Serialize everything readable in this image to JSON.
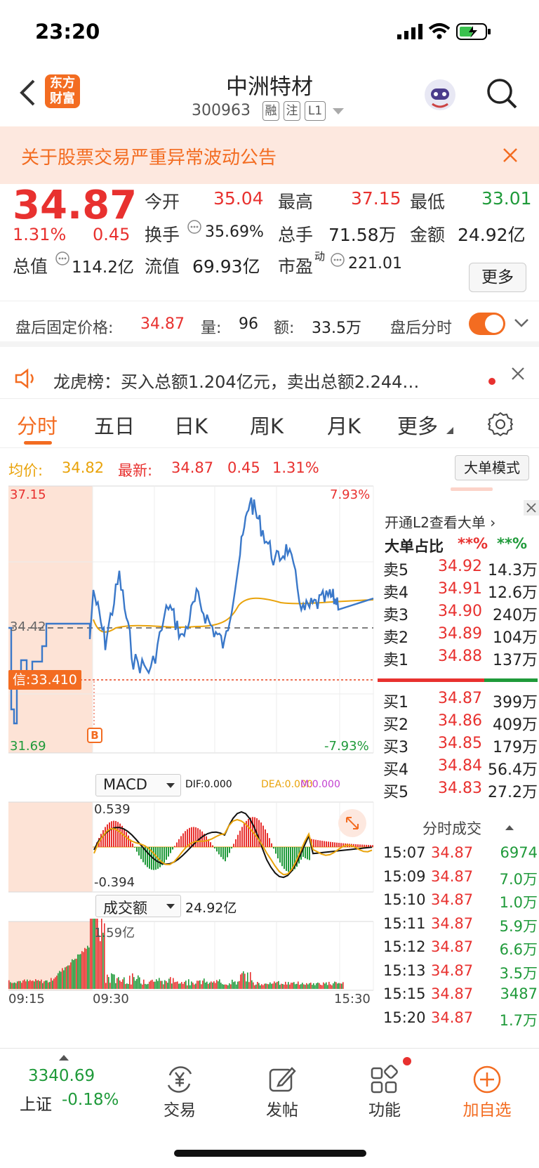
{
  "status": {
    "time": "23:20"
  },
  "header": {
    "title": "中洲特材",
    "code": "300963",
    "badges": [
      "融",
      "注",
      "L1"
    ],
    "logo_line1": "东方",
    "logo_line2": "财富"
  },
  "notice": {
    "text": "关于股票交易严重异常波动公告"
  },
  "quote": {
    "price": "34.87",
    "change_pct": "1.31%",
    "change": "0.45",
    "open_label": "今开",
    "open": "35.04",
    "high_label": "最高",
    "high": "37.15",
    "low_label": "最低",
    "low": "33.01",
    "turnover_label": "换手",
    "turnover": "35.69%",
    "volume_label": "总手",
    "volume": "71.58万",
    "amount_label": "金额",
    "amount": "24.92亿",
    "mktcap_label": "总值",
    "mktcap": "114.2亿",
    "float_label": "流值",
    "float_cap": "69.93亿",
    "pe_label": "市盈",
    "pe_sup": "动",
    "pe": "221.01",
    "more": "更多"
  },
  "afterhours": {
    "price_label": "盘后固定价格:",
    "price": "34.87",
    "vol_label": "量:",
    "vol": "96",
    "amt_label": "额:",
    "amt": "33.5万",
    "timeshare_label": "盘后分时"
  },
  "lhb": {
    "text": "龙虎榜：买入总额1.204亿元，卖出总额2.244…"
  },
  "tabs": [
    "分时",
    "五日",
    "日K",
    "周K",
    "月K",
    "更多"
  ],
  "infoline": {
    "avg_label": "均价:",
    "avg": "34.82",
    "latest_label": "最新:",
    "latest": "34.87",
    "chg": "0.45",
    "pct": "1.31%",
    "bigmode": "大单模式"
  },
  "chart": {
    "y_top": "37.15",
    "y_mid": "34.42",
    "y_bot": "31.69",
    "pct_top": "7.93%",
    "pct_bot": "-7.93%",
    "signal_label": "信:33.410",
    "b_marker": "B",
    "macd_label": "MACD",
    "dif": "DIF:0.000",
    "dea": "DEA:0.000",
    "m": "M:0.000",
    "macd_top": "0.539",
    "macd_bot": "-0.394",
    "vol_label": "成交额",
    "vol_total": "24.92亿",
    "vol_max": "1.59亿",
    "t_start": "09:15",
    "t_open": "09:30",
    "t_end": "15:30"
  },
  "orderbook": {
    "l2_text": "开通L2查看大单",
    "ratio_label": "大单占比",
    "ratio_buy": "**%",
    "ratio_sell": "**%",
    "asks": [
      {
        "label": "卖5",
        "price": "34.92",
        "vol": "14.3万"
      },
      {
        "label": "卖4",
        "price": "34.91",
        "vol": "12.6万"
      },
      {
        "label": "卖3",
        "price": "34.90",
        "vol": "240万"
      },
      {
        "label": "卖2",
        "price": "34.89",
        "vol": "104万"
      },
      {
        "label": "卖1",
        "price": "34.88",
        "vol": "137万"
      }
    ],
    "bids": [
      {
        "label": "买1",
        "price": "34.87",
        "vol": "399万"
      },
      {
        "label": "买2",
        "price": "34.86",
        "vol": "409万"
      },
      {
        "label": "买3",
        "price": "34.85",
        "vol": "179万"
      },
      {
        "label": "买4",
        "price": "34.84",
        "vol": "56.4万"
      },
      {
        "label": "买5",
        "price": "34.83",
        "vol": "27.2万"
      }
    ],
    "trades_title": "分时成交",
    "trades": [
      {
        "t": "15:07",
        "p": "34.87",
        "v": "6974"
      },
      {
        "t": "15:09",
        "p": "34.87",
        "v": "7.0万"
      },
      {
        "t": "15:10",
        "p": "34.87",
        "v": "1.0万"
      },
      {
        "t": "15:11",
        "p": "34.87",
        "v": "5.9万"
      },
      {
        "t": "15:12",
        "p": "34.87",
        "v": "6.6万"
      },
      {
        "t": "15:13",
        "p": "34.87",
        "v": "3.5万"
      },
      {
        "t": "15:15",
        "p": "34.87",
        "v": "3487"
      },
      {
        "t": "15:20",
        "p": "34.87",
        "v": "1.7万"
      }
    ]
  },
  "bottom": {
    "index_val": "3340.69",
    "index_name": "上证",
    "index_pct": "-0.18%",
    "trade": "交易",
    "post": "发帖",
    "func": "功能",
    "add": "加自选"
  },
  "colors": {
    "up": "#e8312f",
    "down": "#1f9a3a",
    "avg": "#e9a30b",
    "accent": "#f36c21",
    "price_line": "#3a78c9"
  }
}
